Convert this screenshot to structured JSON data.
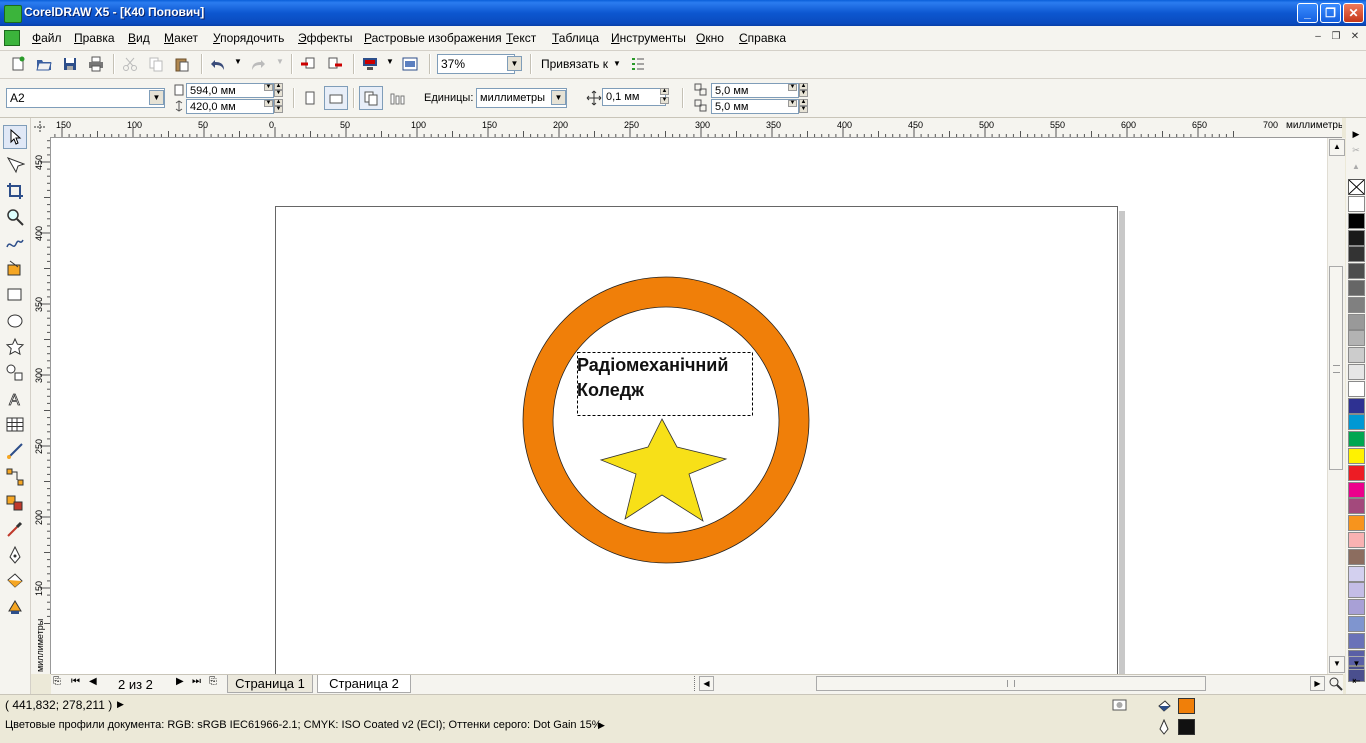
{
  "window": {
    "title": "CorelDRAW X5 - [К40 Попович]",
    "minimize_glyph": "_",
    "maximize_glyph": "❐",
    "close_glyph": "✕"
  },
  "menu": {
    "items": [
      {
        "first": "Ф",
        "rest": "айл"
      },
      {
        "first": "П",
        "rest": "равка"
      },
      {
        "first": "В",
        "rest": "ид"
      },
      {
        "first": "М",
        "rest": "акет"
      },
      {
        "first": "У",
        "rest": "порядочить"
      },
      {
        "first": "Э",
        "rest": "ффекты"
      },
      {
        "first": "Р",
        "rest": "астровые изображения"
      },
      {
        "first": "Т",
        "rest": "екст"
      },
      {
        "first": "Т",
        "rest": "аблица"
      },
      {
        "first": "И",
        "rest": "нструменты"
      },
      {
        "first": "О",
        "rest": "кно"
      },
      {
        "first": "С",
        "rest": "правка"
      }
    ]
  },
  "standard_toolbar": {
    "zoom_value": "37%",
    "snap_label": "Привязать к"
  },
  "property_bar": {
    "paper_size": "A2",
    "width": "594,0 мм",
    "height": "420,0 мм",
    "units_label": "Единицы:",
    "units_value": "миллиметры",
    "nudge": "0,1 мм",
    "dup_x": "5,0 мм",
    "dup_y": "5,0 мм"
  },
  "rulers": {
    "h_ticks": [
      "150",
      "100",
      "50",
      "0",
      "50",
      "100",
      "150",
      "200",
      "250",
      "300",
      "350",
      "400",
      "450",
      "500",
      "550",
      "600",
      "650",
      "700"
    ],
    "h_unit": "миллиметры",
    "v_ticks": [
      "450",
      "400",
      "350",
      "300",
      "250",
      "200",
      "150"
    ],
    "v_unit": "миллиметры"
  },
  "drawing": {
    "text_line1": "Радіомеханічний",
    "text_line2": "Коледж",
    "ring_color": "#f07f09",
    "star_color": "#f7e018"
  },
  "page_nav": {
    "counter": "2 из 2",
    "tabs": [
      "Страница 1",
      "Страница 2"
    ],
    "active_tab": 1
  },
  "status": {
    "coordinates": "( 441,832; 278,211 )",
    "color_profiles": "Цветовые профили документа: RGB: sRGB IEC61966-2.1; CMYK: ISO Coated v2 (ECI); Оттенки серого: Dot Gain 15%",
    "fill_color": "#f07f09",
    "outline_color": "#111111"
  },
  "palette": [
    "#ffffff",
    "#000000",
    "#1a1a1a",
    "#333333",
    "#4d4d4d",
    "#666666",
    "#808080",
    "#999999",
    "#b3b3b3",
    "#cccccc",
    "#e6e6e6",
    "#ffffff",
    "#2e3192",
    "#0098d4",
    "#00a651",
    "#fff200",
    "#ed1c24",
    "#ec008c",
    "#a3497c",
    "#f7941d",
    "#f9b2b2",
    "#8c6d5f",
    "#d3d0ef",
    "#c4bde6",
    "#a8a0d6",
    "#7f95cf",
    "#6a72b8",
    "#5a5fa6",
    "#4a4f8e"
  ]
}
